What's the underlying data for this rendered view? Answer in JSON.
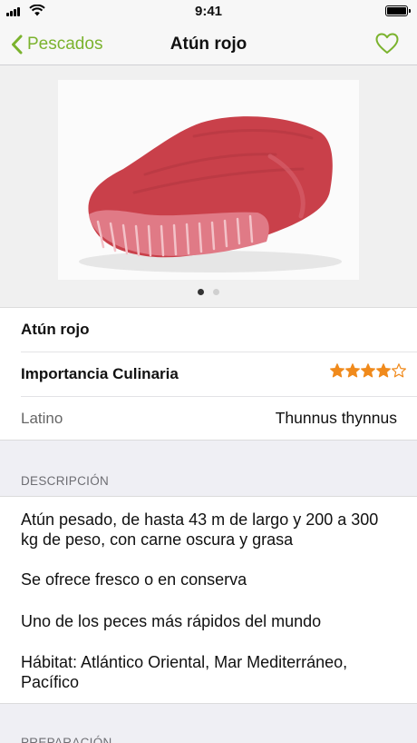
{
  "status_bar": {
    "time": "9:41"
  },
  "nav": {
    "back_label": "Pescados",
    "title": "Atún rojo"
  },
  "gallery": {
    "page_count": 2,
    "current_page": 1
  },
  "info": {
    "name": "Atún rojo",
    "culinary_label": "Importancia Culinaria",
    "culinary_rating": 4,
    "culinary_rating_max": 5,
    "latin_label": "Latino",
    "latin_value": "Thunnus thynnus"
  },
  "description": {
    "header": "DESCRIPCIÓN",
    "paragraphs": [
      "Atún pesado, de hasta 43 m de largo y 200 a 300 kg de peso, con carne oscura y grasa",
      "Se ofrece fresco o en conserva",
      "Uno de los peces más rápidos del mundo",
      "Hábitat: Atlántico Oriental, Mar Mediterráneo, Pacífico"
    ]
  },
  "preparation": {
    "header": "PREPARACIÓN"
  },
  "colors": {
    "accent": "#7bb32e",
    "star": "#f08a1c"
  }
}
